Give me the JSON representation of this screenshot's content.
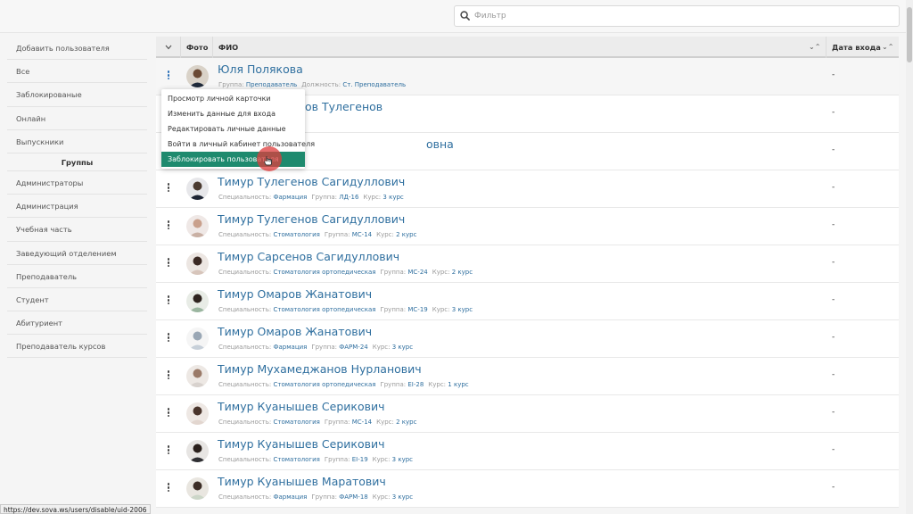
{
  "filter": {
    "placeholder": "Фильтр",
    "value": ""
  },
  "sidebar": {
    "items_top": [
      "Добавить пользователя",
      "Все",
      "Заблокированые",
      "Онлайн",
      "Выпускники"
    ],
    "groups_heading": "Группы",
    "groups": [
      "Администраторы",
      "Администрация",
      "Учебная часть",
      "Заведующий отделением",
      "Преподаватель",
      "Студент",
      "Абитуриент",
      "Преподаватель курсов"
    ]
  },
  "table": {
    "headers": {
      "photo": "Фото",
      "fio": "ФИО",
      "date": "Дата входа"
    },
    "rows": [
      {
        "name": "Юля Полякова",
        "meta": [
          [
            "Группа:",
            "Преподаватель"
          ],
          [
            "Должность:",
            "Ст. Преподаватель"
          ]
        ],
        "date": "-"
      },
      {
        "name": "Тимур Тулегенов",
        "name_visible": "ов Тулегенов",
        "meta": [],
        "date": "-"
      },
      {
        "name": "овна",
        "meta": [],
        "date": "-"
      },
      {
        "name": "Тимур Тулегенов Сагидуллович",
        "meta": [
          [
            "Специальность:",
            "Фармация"
          ],
          [
            "Группа:",
            "ЛД-16"
          ],
          [
            "Курс:",
            "3 курс"
          ]
        ],
        "date": "-"
      },
      {
        "name": "Тимур Тулегенов Сагидуллович",
        "meta": [
          [
            "Специальность:",
            "Стоматология"
          ],
          [
            "Группа:",
            "МС-14"
          ],
          [
            "Курс:",
            "2 курс"
          ]
        ],
        "date": "-"
      },
      {
        "name": "Тимур Сарсенов Сагидуллович",
        "meta": [
          [
            "Специальность:",
            "Стоматология ортопедическая"
          ],
          [
            "Группа:",
            "МС-24"
          ],
          [
            "Курс:",
            "2 курс"
          ]
        ],
        "date": "-"
      },
      {
        "name": "Тимур Омаров Жанатович",
        "meta": [
          [
            "Специальность:",
            "Стоматология ортопедическая"
          ],
          [
            "Группа:",
            "МС-19"
          ],
          [
            "Курс:",
            "3 курс"
          ]
        ],
        "date": "-"
      },
      {
        "name": "Тимур Омаров Жанатович",
        "meta": [
          [
            "Специальность:",
            "Фармация"
          ],
          [
            "Группа:",
            "ФАРМ-24"
          ],
          [
            "Курс:",
            "3 курс"
          ]
        ],
        "date": "-"
      },
      {
        "name": "Тимур Мухамеджанов Нурланович",
        "meta": [
          [
            "Специальность:",
            "Стоматология ортопедическая"
          ],
          [
            "Группа:",
            "ЕI-28"
          ],
          [
            "Курс:",
            "1 курс"
          ]
        ],
        "date": "-"
      },
      {
        "name": "Тимур Куанышев Серикович",
        "meta": [
          [
            "Специальность:",
            "Стоматология"
          ],
          [
            "Группа:",
            "МС-14"
          ],
          [
            "Курс:",
            "2 курс"
          ]
        ],
        "date": "-"
      },
      {
        "name": "Тимур Куанышев Серикович",
        "meta": [
          [
            "Специальность:",
            "Стоматология"
          ],
          [
            "Группа:",
            "ЕI-19"
          ],
          [
            "Курс:",
            "3 курс"
          ]
        ],
        "date": "-"
      },
      {
        "name": "Тимур Куанышев Маратович",
        "meta": [
          [
            "Специальность:",
            "Фармация"
          ],
          [
            "Группа:",
            "ФАРМ-18"
          ],
          [
            "Курс:",
            "3 курс"
          ]
        ],
        "date": "-"
      }
    ]
  },
  "context_menu": {
    "items": [
      "Просмотр личной карточки",
      "Изменить данные для входа",
      "Редактировать личные данные",
      "Войти в личный кабинет пользователя",
      "Заблокировать пользователя"
    ],
    "highlighted_index": 4
  },
  "status_url": "https://dev.sova.ws/users/disable/uid-2006",
  "colors": {
    "link": "#2f6f9f",
    "menu_highlight": "#1e8a6e",
    "click_ring": "#de3c3c"
  },
  "icons": {
    "search": "search-icon",
    "kebab": "kebab-menu-icon",
    "sort": "sort-arrows-icon",
    "select_all": "chevron-down-icon"
  }
}
